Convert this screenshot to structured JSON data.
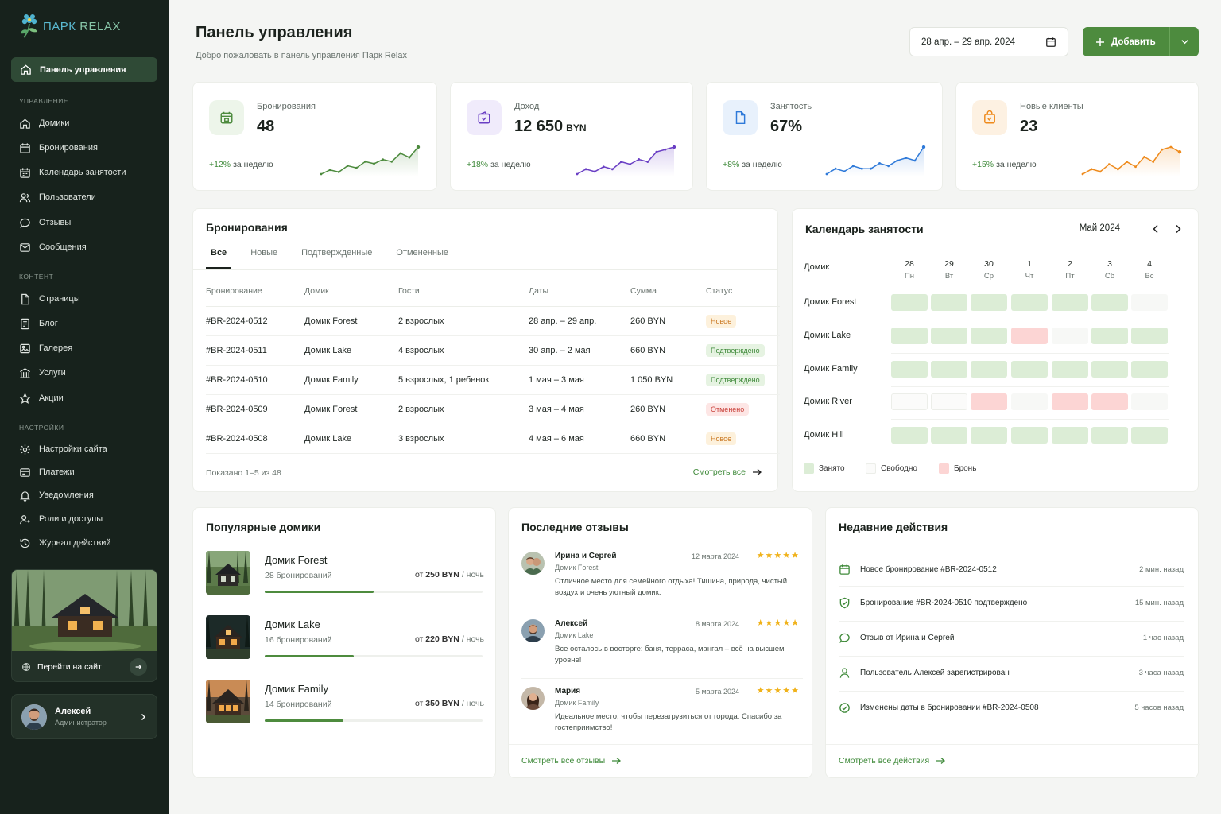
{
  "brand": {
    "part1": "ПАРК",
    "part2": "RELAX"
  },
  "nav": {
    "active": "Панель управления",
    "sections": [
      "Управление",
      "Контент",
      "Настройки"
    ],
    "manage": [
      "Домики",
      "Бронирования",
      "Календарь занятости",
      "Пользователи",
      "Отзывы",
      "Сообщения"
    ],
    "content": [
      "Страницы",
      "Блог",
      "Галерея",
      "Услуги",
      "Акции"
    ],
    "settings": [
      "Настройки сайта",
      "Платежи",
      "Уведомления",
      "Роли и доступы",
      "Журнал действий"
    ]
  },
  "site_link": "Перейти на сайт",
  "user": {
    "name": "Алексей",
    "role": "Администратор"
  },
  "header": {
    "title": "Панель управления",
    "subtitle": "Добро пожаловать в панель управления Парк Relax",
    "date_range": "28 апр. – 29 апр. 2024",
    "add_label": "Добавить"
  },
  "stats": [
    {
      "label": "Бронирования",
      "value": "48",
      "unit": "",
      "change": "+12%",
      "period": "за неделю",
      "color": "#4d8b3e",
      "bg": "#edf5ea",
      "points": [
        3,
        5,
        4,
        7,
        6,
        9,
        8,
        10,
        9,
        13,
        11,
        16
      ]
    },
    {
      "label": "Доход",
      "value": "12 650",
      "unit": "BYN",
      "change": "+18%",
      "period": "за неделю",
      "color": "#6a3fc4",
      "bg": "#f0ebfb",
      "points": [
        2,
        4,
        3,
        5,
        4,
        7,
        6,
        8,
        7,
        11,
        12,
        13
      ]
    },
    {
      "label": "Занятость",
      "value": "67%",
      "unit": "",
      "change": "+8%",
      "period": "за неделю",
      "color": "#2f7ad9",
      "bg": "#e8f1fc",
      "points": [
        3,
        5,
        4,
        6,
        5,
        5,
        7,
        6,
        8,
        9,
        8,
        13
      ]
    },
    {
      "label": "Новые клиенты",
      "value": "23",
      "unit": "",
      "change": "+15%",
      "period": "за неделю",
      "color": "#ee8a1c",
      "bg": "#fdf1e2",
      "points": [
        2,
        4,
        3,
        6,
        4,
        7,
        5,
        9,
        7,
        12,
        13,
        11
      ]
    }
  ],
  "bookings": {
    "title": "Бронирования",
    "tabs": [
      "Все",
      "Новые",
      "Подтвержденные",
      "Отмененные"
    ],
    "headers": [
      "Бронирование",
      "Домик",
      "Гости",
      "Даты",
      "Сумма",
      "Статус"
    ],
    "rows": [
      {
        "id": "#BR-2024-0512",
        "house": "Домик Forest",
        "guests": "2 взрослых",
        "dates": "28 апр. – 29 апр.",
        "sum": "260 BYN",
        "status": "Новое",
        "kind": "new"
      },
      {
        "id": "#BR-2024-0511",
        "house": "Домик Lake",
        "guests": "4 взрослых",
        "dates": "30 апр. – 2 мая",
        "sum": "660 BYN",
        "status": "Подтверждено",
        "kind": "ok"
      },
      {
        "id": "#BR-2024-0510",
        "house": "Домик Family",
        "guests": "5 взрослых, 1 ребенок",
        "dates": "1 мая – 3 мая",
        "sum": "1 050 BYN",
        "status": "Подтверждено",
        "kind": "ok"
      },
      {
        "id": "#BR-2024-0509",
        "house": "Домик Forest",
        "guests": "2 взрослых",
        "dates": "3 мая – 4 мая",
        "sum": "260 BYN",
        "status": "Отменено",
        "kind": "cancel"
      },
      {
        "id": "#BR-2024-0508",
        "house": "Домик Lake",
        "guests": "3 взрослых",
        "dates": "4 мая – 6 мая",
        "sum": "660 BYN",
        "status": "Новое",
        "kind": "new"
      }
    ],
    "shown": "Показано 1–5 из 48",
    "view_all": "Смотреть все"
  },
  "calendar": {
    "title": "Календарь занятости",
    "month": "Май 2024",
    "col_label": "Домик",
    "days": [
      {
        "n": "28",
        "d": "Пн"
      },
      {
        "n": "29",
        "d": "Вт"
      },
      {
        "n": "30",
        "d": "Ср"
      },
      {
        "n": "1",
        "d": "Чт"
      },
      {
        "n": "2",
        "d": "Пт"
      },
      {
        "n": "3",
        "d": "Сб"
      },
      {
        "n": "4",
        "d": "Вс"
      }
    ],
    "rows": [
      {
        "name": "Домик Forest",
        "cells": [
          "b",
          "b",
          "b",
          "b",
          "b",
          "b",
          "f0"
        ]
      },
      {
        "name": "Домик Lake",
        "cells": [
          "b",
          "b",
          "b",
          "r",
          "f0",
          "b",
          "b"
        ]
      },
      {
        "name": "Домик Family",
        "cells": [
          "b",
          "b",
          "b",
          "b",
          "b",
          "b",
          "b"
        ]
      },
      {
        "name": "Домик River",
        "cells": [
          "f",
          "f",
          "r",
          "f0",
          "r",
          "r",
          "f0"
        ]
      },
      {
        "name": "Домик Hill",
        "cells": [
          "b",
          "b",
          "b",
          "b",
          "b",
          "b",
          "b"
        ]
      }
    ],
    "legend": [
      "Занято",
      "Свободно",
      "Бронь"
    ]
  },
  "popular": {
    "title": "Популярные домики",
    "items": [
      {
        "name": "Домик Forest",
        "count": "28 бронирований",
        "from": "от",
        "price": "250 BYN",
        "per": "/ ночь",
        "fill": 0.5
      },
      {
        "name": "Домик Lake",
        "count": "16 бронирований",
        "from": "от",
        "price": "220 BYN",
        "per": "/ ночь",
        "fill": 0.41
      },
      {
        "name": "Домик Family",
        "count": "14 бронирований",
        "from": "от",
        "price": "350 BYN",
        "per": "/ ночь",
        "fill": 0.36
      }
    ]
  },
  "reviews": {
    "title": "Последние отзывы",
    "items": [
      {
        "name": "Ирина и Сергей",
        "house": "Домик Forest",
        "date": "12 марта 2024",
        "stars": "★★★★★",
        "text": "Отличное место для семейного отдыха! Тишина, природа, чистый воздух и очень уютный домик."
      },
      {
        "name": "Алексей",
        "house": "Домик Lake",
        "date": "8 марта 2024",
        "stars": "★★★★★",
        "text": "Все осталось в восторге: баня, терраса, мангал – всё на высшем уровне!"
      },
      {
        "name": "Мария",
        "house": "Домик Family",
        "date": "5 марта 2024",
        "stars": "★★★★★",
        "text": "Идеальное место, чтобы перезагрузиться от города. Спасибо за гостеприимство!"
      }
    ],
    "view_all": "Смотреть все отзывы"
  },
  "activity": {
    "title": "Недавние действия",
    "items": [
      {
        "icon": "calendar-icon",
        "text": "Новое бронирование #BR-2024-0512",
        "time": "2 мин. назад"
      },
      {
        "icon": "shield-check-icon",
        "text": "Бронирование #BR-2024-0510 подтверждено",
        "time": "15 мин. назад"
      },
      {
        "icon": "chat-icon",
        "text": "Отзыв от Ирина и Сергей",
        "time": "1 час назад"
      },
      {
        "icon": "user-icon",
        "text": "Пользователь Алексей зарегистрирован",
        "time": "3 часа назад"
      },
      {
        "icon": "check-circle-icon",
        "text": "Изменены даты в бронировании #BR-2024-0508",
        "time": "5 часов назад"
      }
    ],
    "view_all": "Смотреть все действия"
  }
}
